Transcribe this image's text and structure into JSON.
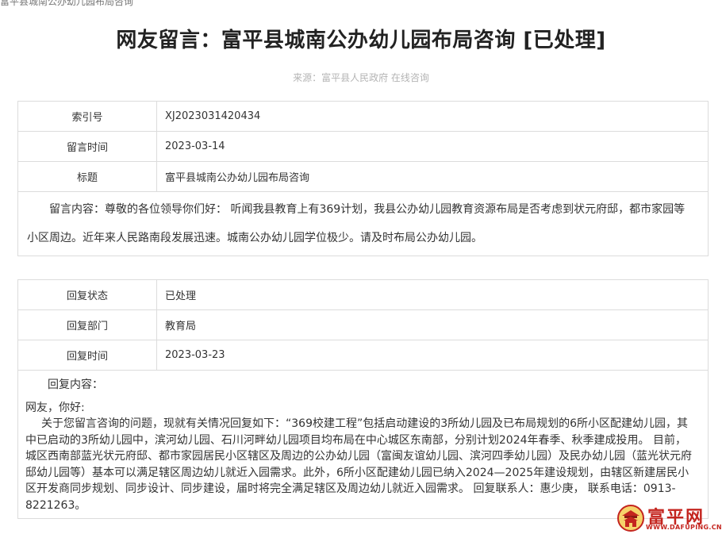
{
  "breadcrumb": "富平县城南公办幼儿园布局咨询",
  "title": "网友留言：富平县城南公办幼儿园布局咨询 [已处理]",
  "source": "来源：富平县人民政府 在线咨询",
  "message": {
    "rows": [
      {
        "label": "索引号",
        "value": "XJ2023031420434"
      },
      {
        "label": "留言时间",
        "value": "2023-03-14"
      },
      {
        "label": "标题",
        "value": "富平县城南公办幼儿园布局咨询"
      }
    ],
    "content": "留言内容：尊敬的各位领导你们好： 听闻我县教育上有369计划，我县公办幼儿园教育资源布局是否考虑到状元府邸，都市家园等小区周边。近年来人民路南段发展迅速。城南公办幼儿园学位极少。请及时布局公办幼儿园。"
  },
  "reply": {
    "rows": [
      {
        "label": "回复状态",
        "value": "已处理"
      },
      {
        "label": "回复部门",
        "value": "教育局"
      },
      {
        "label": "回复时间",
        "value": "2023-03-23"
      }
    ],
    "content_label": "回复内容：",
    "greeting": "网友，你好:",
    "body": "关于您留言咨询的问题，现就有关情况回复如下：“369校建工程”包括启动建设的3所幼儿园及已布局规划的6所小区配建幼儿园，其中已启动的3所幼儿园中，滨河幼儿园、石川河畔幼儿园项目均布局在中心城区东南部，分别计划2024年春季、秋季建成投用。 目前，城区西南部蓝光状元府邸、都市家园居民小区辖区及周边的公办幼儿园（富闽友谊幼儿园、滨河四季幼儿园）及民办幼儿园（蓝光状元府邸幼儿园等）基本可以满足辖区周边幼儿就近入园需求。此外，6所小区配建幼儿园已纳入2024—2025年建设规划，由辖区新建居民小区开发商同步规划、同步设计、同步建设，届时将完全满足辖区及周边幼儿就近入园需求。 回复联系人：惠少庚， 联系电话：0913-8221263。"
  },
  "watermark": {
    "name": "富平网",
    "url": "WWW.DAFUPING.CN"
  },
  "colors": {
    "border": "#dcdcdc",
    "source_text": "#b4b4b4",
    "watermark_red": "#c4251f"
  }
}
